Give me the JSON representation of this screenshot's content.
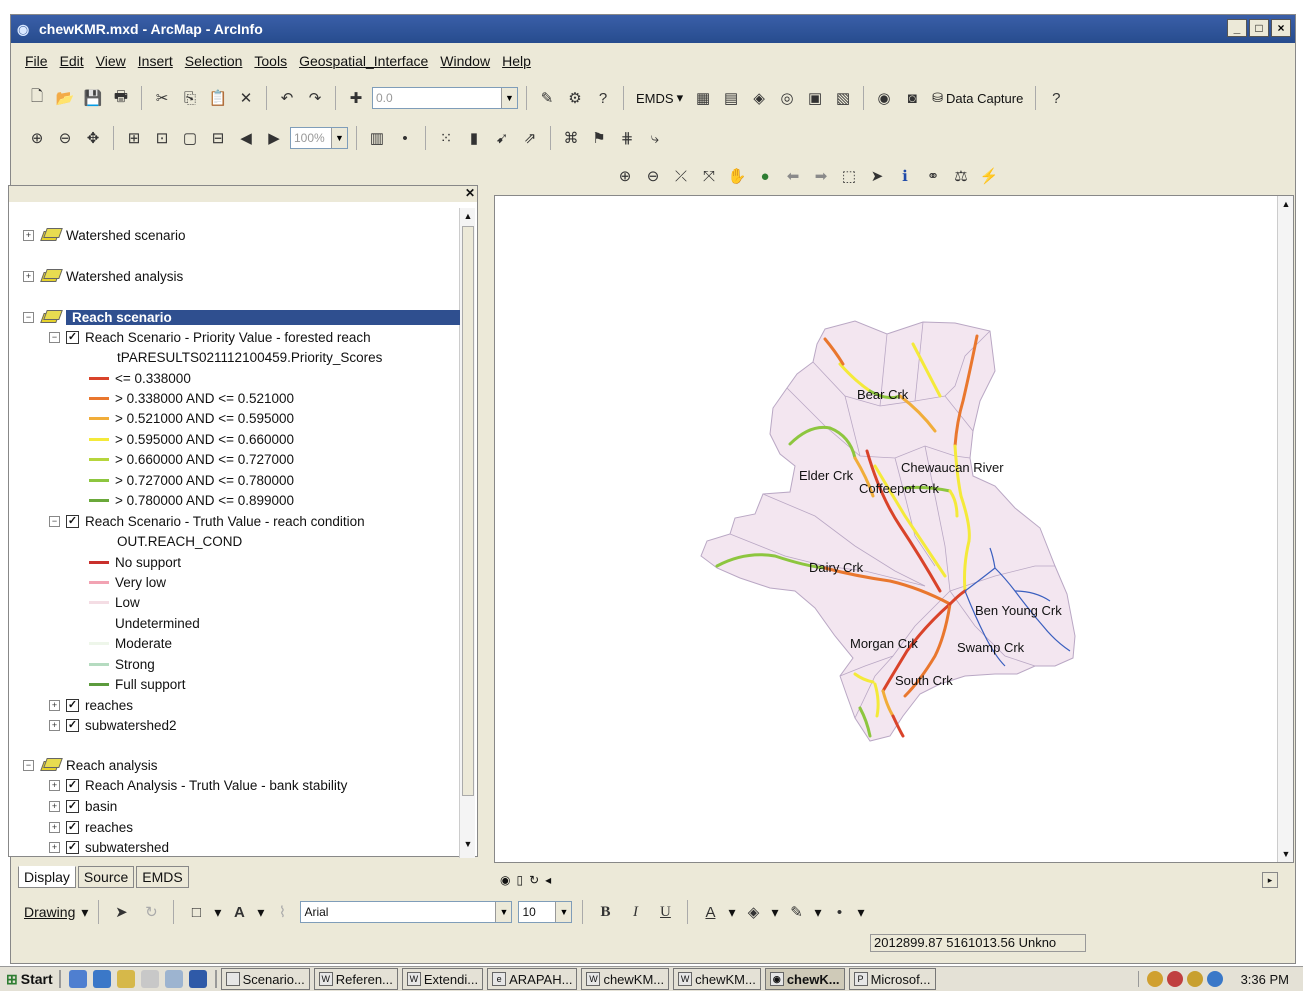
{
  "window": {
    "title": "chewKMR.mxd - ArcMap - ArcInfo",
    "min": "_",
    "max": "□",
    "close": "×"
  },
  "menu": [
    "File",
    "Edit",
    "View",
    "Insert",
    "Selection",
    "Tools",
    "Geospatial_Interface",
    "Window",
    "Help"
  ],
  "toolbar": {
    "scale_value": "0.0",
    "emds_label": "EMDS",
    "data_capture_label": "Data Capture",
    "zoom_value": "100%"
  },
  "toc": {
    "groups": [
      {
        "label": "Watershed scenario",
        "expanded": false
      },
      {
        "label": "Watershed analysis",
        "expanded": false
      },
      {
        "label": "Reach scenario",
        "expanded": true,
        "selected": true
      },
      {
        "label": "Reach analysis",
        "expanded": true
      }
    ],
    "priority_layer": {
      "label": "Reach Scenario - Priority Value - forested reach",
      "field": "tPARESULTS021112100459.Priority_Scores",
      "classes": [
        {
          "label": "<= 0.338000",
          "color": "#d9432a"
        },
        {
          "label": "> 0.338000 AND <= 0.521000",
          "color": "#e9772e"
        },
        {
          "label": "> 0.521000 AND <= 0.595000",
          "color": "#f1ad3a"
        },
        {
          "label": "> 0.595000 AND <= 0.660000",
          "color": "#f4ea3a"
        },
        {
          "label": "> 0.660000 AND <= 0.727000",
          "color": "#b6d53c"
        },
        {
          "label": "> 0.727000 AND <= 0.780000",
          "color": "#8dc63f"
        },
        {
          "label": "> 0.780000 AND <= 0.899000",
          "color": "#6aa83a"
        }
      ]
    },
    "truth_layer": {
      "label": "Reach Scenario - Truth Value - reach condition",
      "field": "OUT.REACH_COND",
      "classes": [
        {
          "label": "No support",
          "color": "#c9302c"
        },
        {
          "label": "Very low",
          "color": "#f2a3b3"
        },
        {
          "label": "Low",
          "color": "#f4dde4"
        },
        {
          "label": "Undetermined",
          "color": "#ffffff"
        },
        {
          "label": "Moderate",
          "color": "#eef6ea"
        },
        {
          "label": "Strong",
          "color": "#b5dbc0"
        },
        {
          "label": "Full support",
          "color": "#5c9b3d"
        }
      ]
    },
    "reach_scenario_extra": [
      "reaches",
      "subwatershed2"
    ],
    "reach_analysis_layers": [
      "Reach Analysis - Truth Value - bank stability",
      "basin",
      "reaches",
      "subwatershed"
    ]
  },
  "tabs": [
    "Display",
    "Source",
    "EMDS"
  ],
  "map_labels": [
    "Bear Crk",
    "Elder Crk",
    "Chewaucan River",
    "Coffeepot Crk",
    "Dairy Crk",
    "Ben Young Crk",
    "Morgan Crk",
    "Swamp Crk",
    "South Crk"
  ],
  "drawing": {
    "label": "Drawing",
    "font": "Arial",
    "size": "10"
  },
  "status": {
    "coords": "2012899.87  5161013.56 Unkno"
  },
  "taskbar": {
    "start": "Start",
    "tasks": [
      {
        "label": "Scenario...",
        "active": false
      },
      {
        "label": "Referen...",
        "active": false
      },
      {
        "label": "Extendi...",
        "active": false
      },
      {
        "label": "ARAPAH...",
        "active": false
      },
      {
        "label": "chewKM...",
        "active": false
      },
      {
        "label": "chewKM...",
        "active": false
      },
      {
        "label": "chewK...",
        "active": true
      },
      {
        "label": "Microsof...",
        "active": false
      }
    ],
    "clock": "3:36 PM"
  }
}
